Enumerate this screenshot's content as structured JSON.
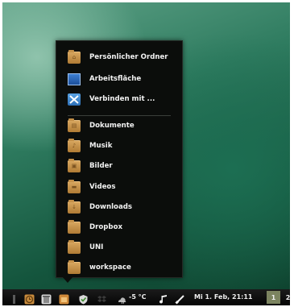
{
  "places_menu": {
    "top_items": [
      {
        "label": "Persönlicher Ordner",
        "icon": "home-folder-icon"
      },
      {
        "label": "Arbeitsfläche",
        "icon": "desktop-icon"
      },
      {
        "label": "Verbinden mit ...",
        "icon": "connect-to-server-icon"
      }
    ],
    "folders": [
      {
        "label": "Dokumente",
        "icon": "documents-folder-icon"
      },
      {
        "label": "Musik",
        "icon": "music-folder-icon"
      },
      {
        "label": "Bilder",
        "icon": "pictures-folder-icon"
      },
      {
        "label": "Videos",
        "icon": "videos-folder-icon"
      },
      {
        "label": "Downloads",
        "icon": "downloads-folder-icon"
      },
      {
        "label": "Dropbox",
        "icon": "folder-icon"
      },
      {
        "label": "UNI",
        "icon": "folder-icon"
      },
      {
        "label": "workspace",
        "icon": "folder-icon"
      }
    ]
  },
  "panel": {
    "temperature": "-5 °C",
    "clock": "Mi  1. Feb, 21:11",
    "workspaces": [
      "1",
      "2"
    ],
    "active_workspace": "1"
  },
  "colors": {
    "menu_background": "#0b0d0b",
    "folder": "#c99449",
    "active_workspace": "#7c8460"
  }
}
